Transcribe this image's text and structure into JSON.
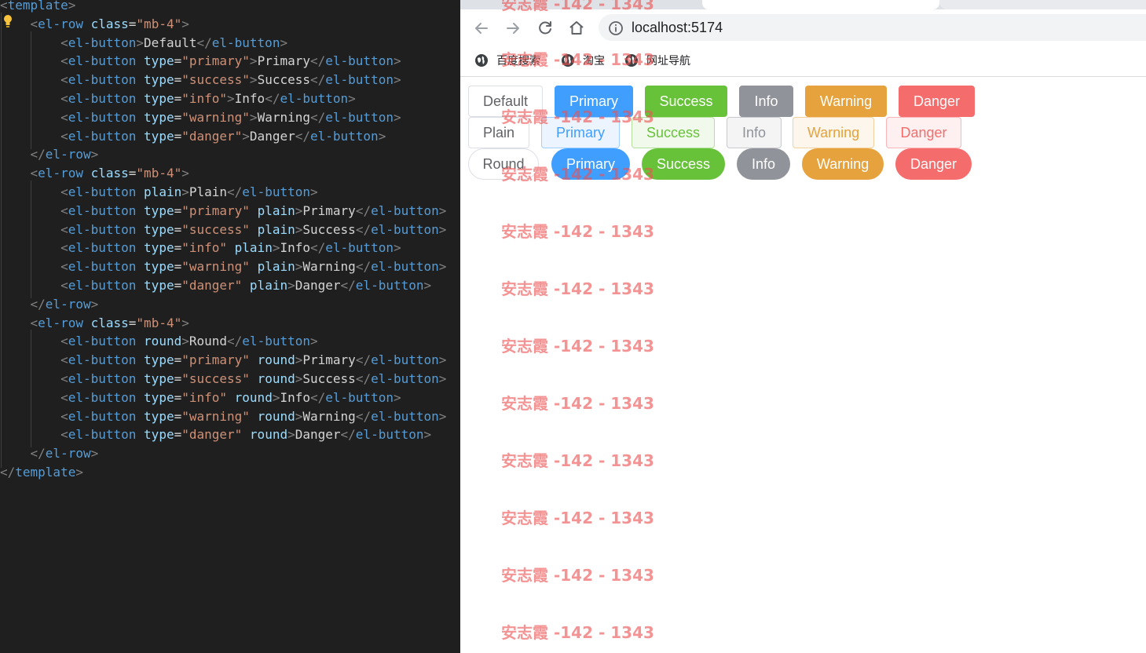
{
  "editor": {
    "lines": [
      [
        [
          "brk",
          "<"
        ],
        [
          "tag",
          "template"
        ],
        [
          "brk",
          ">"
        ]
      ],
      [
        [
          "txt",
          "    "
        ],
        [
          "brk",
          "<"
        ],
        [
          "tag",
          "el-row"
        ],
        [
          "txt",
          " "
        ],
        [
          "attr",
          "class"
        ],
        [
          "txt",
          "="
        ],
        [
          "str",
          "\"mb-4\""
        ],
        [
          "brk",
          ">"
        ]
      ],
      [
        [
          "txt",
          "        "
        ],
        [
          "brk",
          "<"
        ],
        [
          "tag",
          "el-button"
        ],
        [
          "brk",
          ">"
        ],
        [
          "txt",
          "Default"
        ],
        [
          "brk",
          "</"
        ],
        [
          "tag",
          "el-button"
        ],
        [
          "brk",
          ">"
        ]
      ],
      [
        [
          "txt",
          "        "
        ],
        [
          "brk",
          "<"
        ],
        [
          "tag",
          "el-button"
        ],
        [
          "txt",
          " "
        ],
        [
          "attr",
          "type"
        ],
        [
          "txt",
          "="
        ],
        [
          "str",
          "\"primary\""
        ],
        [
          "brk",
          ">"
        ],
        [
          "txt",
          "Primary"
        ],
        [
          "brk",
          "</"
        ],
        [
          "tag",
          "el-button"
        ],
        [
          "brk",
          ">"
        ]
      ],
      [
        [
          "txt",
          "        "
        ],
        [
          "brk",
          "<"
        ],
        [
          "tag",
          "el-button"
        ],
        [
          "txt",
          " "
        ],
        [
          "attr",
          "type"
        ],
        [
          "txt",
          "="
        ],
        [
          "str",
          "\"success\""
        ],
        [
          "brk",
          ">"
        ],
        [
          "txt",
          "Success"
        ],
        [
          "brk",
          "</"
        ],
        [
          "tag",
          "el-button"
        ],
        [
          "brk",
          ">"
        ]
      ],
      [
        [
          "txt",
          "        "
        ],
        [
          "brk",
          "<"
        ],
        [
          "tag",
          "el-button"
        ],
        [
          "txt",
          " "
        ],
        [
          "attr",
          "type"
        ],
        [
          "txt",
          "="
        ],
        [
          "str",
          "\"info\""
        ],
        [
          "brk",
          ">"
        ],
        [
          "txt",
          "Info"
        ],
        [
          "brk",
          "</"
        ],
        [
          "tag",
          "el-button"
        ],
        [
          "brk",
          ">"
        ]
      ],
      [
        [
          "txt",
          "        "
        ],
        [
          "brk",
          "<"
        ],
        [
          "tag",
          "el-button"
        ],
        [
          "txt",
          " "
        ],
        [
          "attr",
          "type"
        ],
        [
          "txt",
          "="
        ],
        [
          "str",
          "\"warning\""
        ],
        [
          "brk",
          ">"
        ],
        [
          "txt",
          "Warning"
        ],
        [
          "brk",
          "</"
        ],
        [
          "tag",
          "el-button"
        ],
        [
          "brk",
          ">"
        ]
      ],
      [
        [
          "txt",
          "        "
        ],
        [
          "brk",
          "<"
        ],
        [
          "tag",
          "el-button"
        ],
        [
          "txt",
          " "
        ],
        [
          "attr",
          "type"
        ],
        [
          "txt",
          "="
        ],
        [
          "str",
          "\"danger\""
        ],
        [
          "brk",
          ">"
        ],
        [
          "txt",
          "Danger"
        ],
        [
          "brk",
          "</"
        ],
        [
          "tag",
          "el-button"
        ],
        [
          "brk",
          ">"
        ]
      ],
      [
        [
          "txt",
          "    "
        ],
        [
          "brk",
          "</"
        ],
        [
          "tag",
          "el-row"
        ],
        [
          "brk",
          ">"
        ]
      ],
      [
        [
          "txt",
          "    "
        ],
        [
          "brk",
          "<"
        ],
        [
          "tag",
          "el-row"
        ],
        [
          "txt",
          " "
        ],
        [
          "attr",
          "class"
        ],
        [
          "txt",
          "="
        ],
        [
          "str",
          "\"mb-4\""
        ],
        [
          "brk",
          ">"
        ]
      ],
      [
        [
          "txt",
          "        "
        ],
        [
          "brk",
          "<"
        ],
        [
          "tag",
          "el-button"
        ],
        [
          "txt",
          " "
        ],
        [
          "attr",
          "plain"
        ],
        [
          "brk",
          ">"
        ],
        [
          "txt",
          "Plain"
        ],
        [
          "brk",
          "</"
        ],
        [
          "tag",
          "el-button"
        ],
        [
          "brk",
          ">"
        ]
      ],
      [
        [
          "txt",
          "        "
        ],
        [
          "brk",
          "<"
        ],
        [
          "tag",
          "el-button"
        ],
        [
          "txt",
          " "
        ],
        [
          "attr",
          "type"
        ],
        [
          "txt",
          "="
        ],
        [
          "str",
          "\"primary\""
        ],
        [
          "txt",
          " "
        ],
        [
          "attr",
          "plain"
        ],
        [
          "brk",
          ">"
        ],
        [
          "txt",
          "Primary"
        ],
        [
          "brk",
          "</"
        ],
        [
          "tag",
          "el-button"
        ],
        [
          "brk",
          ">"
        ]
      ],
      [
        [
          "txt",
          "        "
        ],
        [
          "brk",
          "<"
        ],
        [
          "tag",
          "el-button"
        ],
        [
          "txt",
          " "
        ],
        [
          "attr",
          "type"
        ],
        [
          "txt",
          "="
        ],
        [
          "str",
          "\"success\""
        ],
        [
          "txt",
          " "
        ],
        [
          "attr",
          "plain"
        ],
        [
          "brk",
          ">"
        ],
        [
          "txt",
          "Success"
        ],
        [
          "brk",
          "</"
        ],
        [
          "tag",
          "el-button"
        ],
        [
          "brk",
          ">"
        ]
      ],
      [
        [
          "txt",
          "        "
        ],
        [
          "brk",
          "<"
        ],
        [
          "tag",
          "el-button"
        ],
        [
          "txt",
          " "
        ],
        [
          "attr",
          "type"
        ],
        [
          "txt",
          "="
        ],
        [
          "str",
          "\"info\""
        ],
        [
          "txt",
          " "
        ],
        [
          "attr",
          "plain"
        ],
        [
          "brk",
          ">"
        ],
        [
          "txt",
          "Info"
        ],
        [
          "brk",
          "</"
        ],
        [
          "tag",
          "el-button"
        ],
        [
          "brk",
          ">"
        ]
      ],
      [
        [
          "txt",
          "        "
        ],
        [
          "brk",
          "<"
        ],
        [
          "tag",
          "el-button"
        ],
        [
          "txt",
          " "
        ],
        [
          "attr",
          "type"
        ],
        [
          "txt",
          "="
        ],
        [
          "str",
          "\"warning\""
        ],
        [
          "txt",
          " "
        ],
        [
          "attr",
          "plain"
        ],
        [
          "brk",
          ">"
        ],
        [
          "txt",
          "Warning"
        ],
        [
          "brk",
          "</"
        ],
        [
          "tag",
          "el-button"
        ],
        [
          "brk",
          ">"
        ]
      ],
      [
        [
          "txt",
          "        "
        ],
        [
          "brk",
          "<"
        ],
        [
          "tag",
          "el-button"
        ],
        [
          "txt",
          " "
        ],
        [
          "attr",
          "type"
        ],
        [
          "txt",
          "="
        ],
        [
          "str",
          "\"danger\""
        ],
        [
          "txt",
          " "
        ],
        [
          "attr",
          "plain"
        ],
        [
          "brk",
          ">"
        ],
        [
          "txt",
          "Danger"
        ],
        [
          "brk",
          "</"
        ],
        [
          "tag",
          "el-button"
        ],
        [
          "brk",
          ">"
        ]
      ],
      [
        [
          "txt",
          "    "
        ],
        [
          "brk",
          "</"
        ],
        [
          "tag",
          "el-row"
        ],
        [
          "brk",
          ">"
        ]
      ],
      [
        [
          "txt",
          "    "
        ],
        [
          "brk",
          "<"
        ],
        [
          "tag",
          "el-row"
        ],
        [
          "txt",
          " "
        ],
        [
          "attr",
          "class"
        ],
        [
          "txt",
          "="
        ],
        [
          "str",
          "\"mb-4\""
        ],
        [
          "brk",
          ">"
        ]
      ],
      [
        [
          "txt",
          "        "
        ],
        [
          "brk",
          "<"
        ],
        [
          "tag",
          "el-button"
        ],
        [
          "txt",
          " "
        ],
        [
          "attr",
          "round"
        ],
        [
          "brk",
          ">"
        ],
        [
          "txt",
          "Round"
        ],
        [
          "brk",
          "</"
        ],
        [
          "tag",
          "el-button"
        ],
        [
          "brk",
          ">"
        ]
      ],
      [
        [
          "txt",
          "        "
        ],
        [
          "brk",
          "<"
        ],
        [
          "tag",
          "el-button"
        ],
        [
          "txt",
          " "
        ],
        [
          "attr",
          "type"
        ],
        [
          "txt",
          "="
        ],
        [
          "str",
          "\"primary\""
        ],
        [
          "txt",
          " "
        ],
        [
          "attr",
          "round"
        ],
        [
          "brk",
          ">"
        ],
        [
          "txt",
          "Primary"
        ],
        [
          "brk",
          "</"
        ],
        [
          "tag",
          "el-button"
        ],
        [
          "brk",
          ">"
        ]
      ],
      [
        [
          "txt",
          "        "
        ],
        [
          "brk",
          "<"
        ],
        [
          "tag",
          "el-button"
        ],
        [
          "txt",
          " "
        ],
        [
          "attr",
          "type"
        ],
        [
          "txt",
          "="
        ],
        [
          "str",
          "\"success\""
        ],
        [
          "txt",
          " "
        ],
        [
          "attr",
          "round"
        ],
        [
          "brk",
          ">"
        ],
        [
          "txt",
          "Success"
        ],
        [
          "brk",
          "</"
        ],
        [
          "tag",
          "el-button"
        ],
        [
          "brk",
          ">"
        ]
      ],
      [
        [
          "txt",
          "        "
        ],
        [
          "brk",
          "<"
        ],
        [
          "tag",
          "el-button"
        ],
        [
          "txt",
          " "
        ],
        [
          "attr",
          "type"
        ],
        [
          "txt",
          "="
        ],
        [
          "str",
          "\"info\""
        ],
        [
          "txt",
          " "
        ],
        [
          "attr",
          "round"
        ],
        [
          "brk",
          ">"
        ],
        [
          "txt",
          "Info"
        ],
        [
          "brk",
          "</"
        ],
        [
          "tag",
          "el-button"
        ],
        [
          "brk",
          ">"
        ]
      ],
      [
        [
          "txt",
          "        "
        ],
        [
          "brk",
          "<"
        ],
        [
          "tag",
          "el-button"
        ],
        [
          "txt",
          " "
        ],
        [
          "attr",
          "type"
        ],
        [
          "txt",
          "="
        ],
        [
          "str",
          "\"warning\""
        ],
        [
          "txt",
          " "
        ],
        [
          "attr",
          "round"
        ],
        [
          "brk",
          ">"
        ],
        [
          "txt",
          "Warning"
        ],
        [
          "brk",
          "</"
        ],
        [
          "tag",
          "el-button"
        ],
        [
          "brk",
          ">"
        ]
      ],
      [
        [
          "txt",
          "        "
        ],
        [
          "brk",
          "<"
        ],
        [
          "tag",
          "el-button"
        ],
        [
          "txt",
          " "
        ],
        [
          "attr",
          "type"
        ],
        [
          "txt",
          "="
        ],
        [
          "str",
          "\"danger\""
        ],
        [
          "txt",
          " "
        ],
        [
          "attr",
          "round"
        ],
        [
          "brk",
          ">"
        ],
        [
          "txt",
          "Danger"
        ],
        [
          "brk",
          "</"
        ],
        [
          "tag",
          "el-button"
        ],
        [
          "brk",
          ">"
        ]
      ],
      [
        [
          "txt",
          "    "
        ],
        [
          "brk",
          "</"
        ],
        [
          "tag",
          "el-row"
        ],
        [
          "brk",
          ">"
        ]
      ],
      [
        [
          "brk",
          "</"
        ],
        [
          "tag",
          "template"
        ],
        [
          "brk",
          ">"
        ]
      ]
    ]
  },
  "browser": {
    "url": "localhost:5174",
    "toolbar_icons": [
      "back-arrow-icon",
      "forward-arrow-icon",
      "reload-icon",
      "home-icon",
      "site-info-icon"
    ],
    "bookmarks": [
      {
        "label": "百度搜索",
        "icon": "globe-icon"
      },
      {
        "label": "淘宝",
        "icon": "globe-icon"
      },
      {
        "label": "网址导航",
        "icon": "globe-icon"
      }
    ]
  },
  "buttons": {
    "row1": [
      {
        "label": "Default",
        "type": "default"
      },
      {
        "label": "Primary",
        "type": "primary"
      },
      {
        "label": "Success",
        "type": "success"
      },
      {
        "label": "Info",
        "type": "info"
      },
      {
        "label": "Warning",
        "type": "warning"
      },
      {
        "label": "Danger",
        "type": "danger"
      }
    ],
    "row2": [
      {
        "label": "Plain",
        "type": "default"
      },
      {
        "label": "Primary",
        "type": "primary"
      },
      {
        "label": "Success",
        "type": "success"
      },
      {
        "label": "Info",
        "type": "info"
      },
      {
        "label": "Warning",
        "type": "warning"
      },
      {
        "label": "Danger",
        "type": "danger"
      }
    ],
    "row3": [
      {
        "label": "Round",
        "type": "default"
      },
      {
        "label": "Primary",
        "type": "primary"
      },
      {
        "label": "Success",
        "type": "success"
      },
      {
        "label": "Info",
        "type": "info"
      },
      {
        "label": "Warning",
        "type": "warning"
      },
      {
        "label": "Danger",
        "type": "danger"
      }
    ]
  },
  "watermark": {
    "text": "安志霞 -142 - 1343"
  },
  "colors": {
    "primary": "#409eff",
    "success": "#67c23a",
    "info": "#909399",
    "warning": "#e6a23c",
    "danger": "#f56c6c",
    "editor_bg": "#1f1f1f",
    "watermark": "#ee5050"
  }
}
